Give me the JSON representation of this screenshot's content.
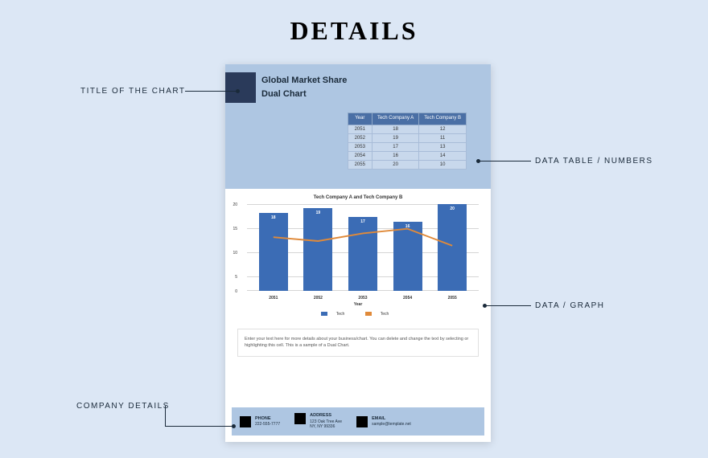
{
  "heading": "DETAILS",
  "title": {
    "line1": "Global Market Share",
    "line2": "Dual Chart"
  },
  "table": {
    "headers": [
      "Year",
      "Tech Company A",
      "Tech Company B"
    ],
    "rows": [
      [
        "2051",
        "18",
        "12"
      ],
      [
        "2052",
        "19",
        "11"
      ],
      [
        "2053",
        "17",
        "13"
      ],
      [
        "2054",
        "16",
        "14"
      ],
      [
        "2055",
        "20",
        "10"
      ]
    ]
  },
  "chart_data": {
    "type": "bar",
    "title": "Tech Company A and Tech Company B",
    "categories": [
      "2051",
      "2052",
      "2053",
      "2054",
      "2055"
    ],
    "series": [
      {
        "name": "Tech",
        "type": "bar",
        "values": [
          18,
          19,
          17,
          16,
          20
        ],
        "color": "#3b6cb5"
      },
      {
        "name": "Tech",
        "type": "line",
        "values": [
          12,
          11,
          13,
          14,
          10
        ],
        "color": "#e08a3a"
      }
    ],
    "xlabel": "Year",
    "ylabel": "",
    "ylim": [
      0,
      20
    ],
    "yticks": [
      0,
      5,
      10,
      15,
      20
    ]
  },
  "description": "Enter your text here for more details about your business/chart. You can delete and change the text by selecting or highlighting this cell. This is a sample of a Dual Chart.",
  "footer": {
    "phone": {
      "label": "PHONE",
      "value": "222-555-7777"
    },
    "address": {
      "label": "ADDRESS",
      "line1": "123 Oak Tree Ave",
      "line2": "NY, NY 99336"
    },
    "email": {
      "label": "EMAIL",
      "value": "sample@template.net"
    }
  },
  "annotations": {
    "title": "TITLE OF THE CHART",
    "table": "DATA TABLE / NUMBERS",
    "graph": "DATA / GRAPH",
    "company": "COMPANY DETAILS"
  }
}
